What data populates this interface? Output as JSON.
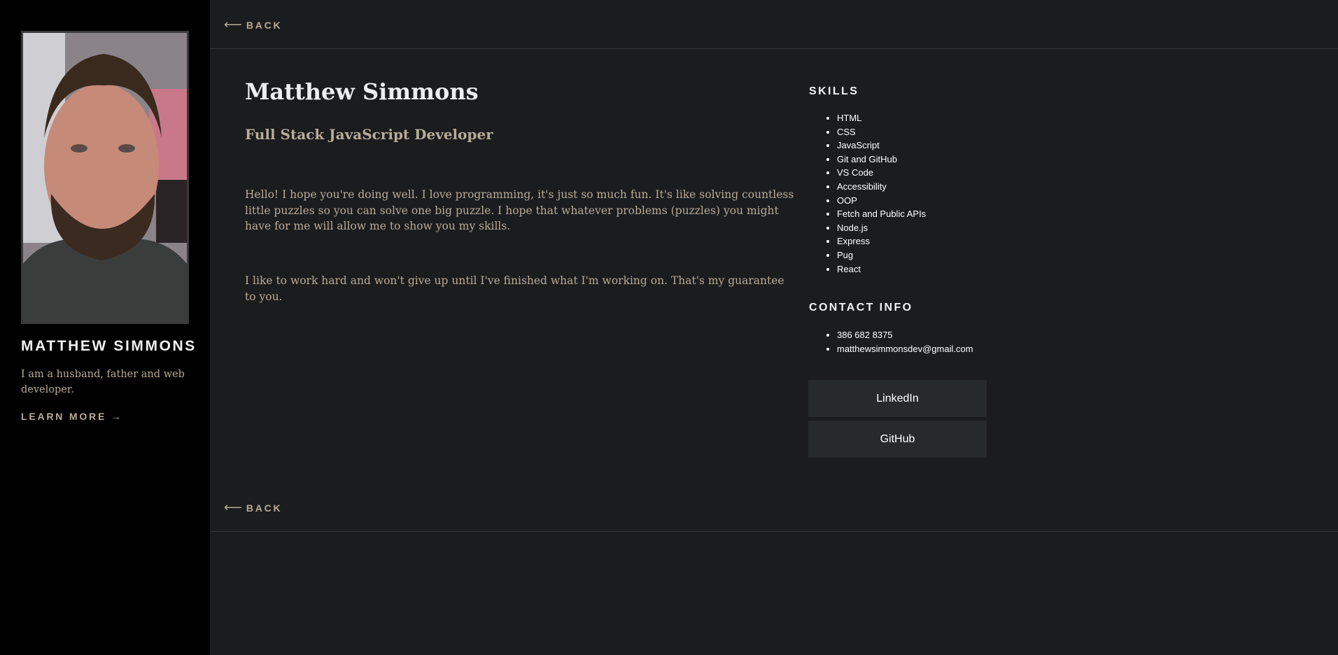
{
  "sidebar": {
    "photo_alt": "Matthew Simmons",
    "name": "MATTHEW SIMMONS",
    "bio": "I am a husband, father and web developer.",
    "learn_more": "LEARN MORE →"
  },
  "nav": {
    "back_arrow": "⟵",
    "back_label": "BACK"
  },
  "profile": {
    "name": "Matthew Simmons",
    "title": "Full Stack JavaScript Developer",
    "paragraphs": [
      "Hello! I hope you're doing well. I love programming, it's just so much fun. It's like solving countless little puzzles so you can solve one big puzzle. I hope that whatever problems (puzzles) you might have for me will allow me to show you my skills.",
      "I like to work hard and won't give up until I've finished what I'm working on. That's my guarantee to you."
    ]
  },
  "skills": {
    "heading": "SKILLS",
    "items": [
      "HTML",
      "CSS",
      "JavaScript",
      "Git and GitHub",
      "VS Code",
      "Accessibility",
      "OOP",
      "Fetch and Public APIs",
      "Node.js",
      "Express",
      "Pug",
      "React"
    ]
  },
  "contact": {
    "heading": "CONTACT INFO",
    "items": [
      "386 682 8375",
      "matthewsimmonsdev@gmail.com"
    ]
  },
  "links": {
    "linkedin": "LinkedIn",
    "github": "GitHub"
  },
  "colors": {
    "page_bg": "#1b1c1e",
    "sidebar_bg": "#000000",
    "muted_text": "#b8ab97",
    "button_bg": "#272a2b"
  }
}
